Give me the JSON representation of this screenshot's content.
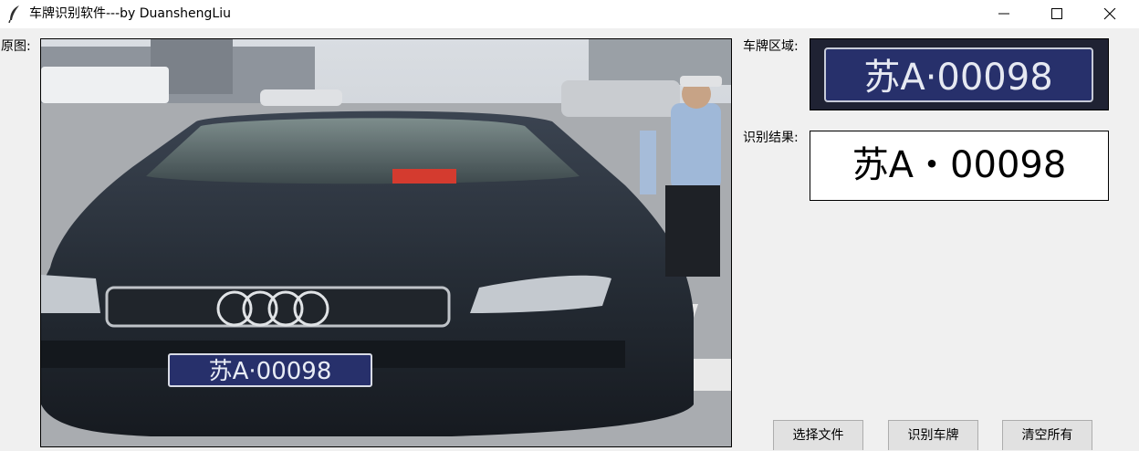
{
  "window": {
    "title": "车牌识别软件---by DuanshengLiu",
    "icon": "feather-icon"
  },
  "labels": {
    "original": "原图:",
    "plate_region": "车牌区域:",
    "result": "识别结果:"
  },
  "plate_image": {
    "text": "苏A·00098",
    "background": "#27306b"
  },
  "result_text": "苏A・00098",
  "buttons": {
    "select_file": "选择文件",
    "recognize": "识别车牌",
    "clear_all": "清空所有"
  },
  "colors": {
    "plate_blue": "#27306b",
    "window_bg": "#f0f0f0"
  }
}
